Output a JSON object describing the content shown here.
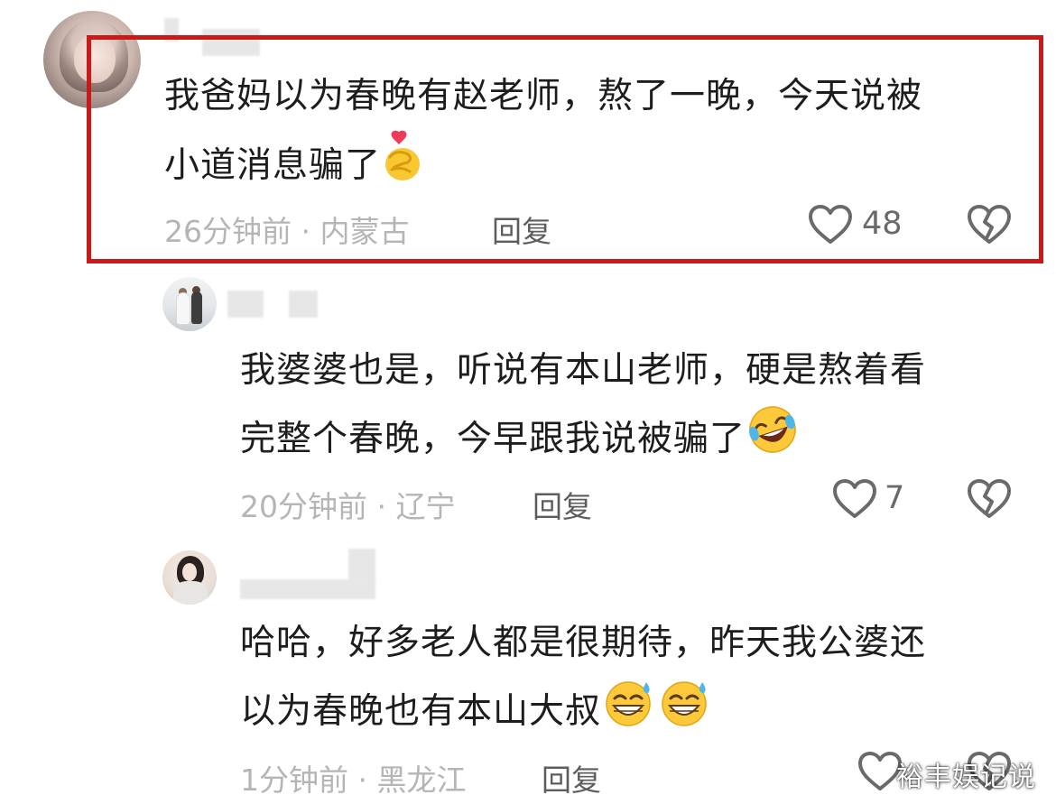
{
  "comments": [
    {
      "line1": "我爸妈以为春晚有赵老师，熬了一晚，今天说被",
      "line2": "小道消息骗了",
      "emoji": "finger-heart-emoji",
      "time": "26分钟前",
      "location": "内蒙古",
      "reply": "回复",
      "likes": "48"
    },
    {
      "line1": "我婆婆也是，听说有本山老师，硬是熬着看",
      "line2": "完整个春晚，今早跟我说被骗了",
      "emoji": "rolling-laughing-emoji",
      "time": "20分钟前",
      "location": "辽宁",
      "reply": "回复",
      "likes": "7"
    },
    {
      "line1": "哈哈，好多老人都是很期待，昨天我公婆还",
      "line2": "以为春晚也有本山大叔",
      "emoji": "grinning-sweat-emoji",
      "time": "1分钟前",
      "location": "黑龙江",
      "reply": "回复",
      "likes": ""
    }
  ],
  "separator": " · ",
  "watermark": "裕丰娱记说",
  "colors": {
    "highlight_border": "#c91a1a",
    "text": "#1d1d1d",
    "meta": "#b5b5b5"
  },
  "icons": {
    "like": "heart-outline-icon",
    "dislike": "broken-heart-icon"
  }
}
